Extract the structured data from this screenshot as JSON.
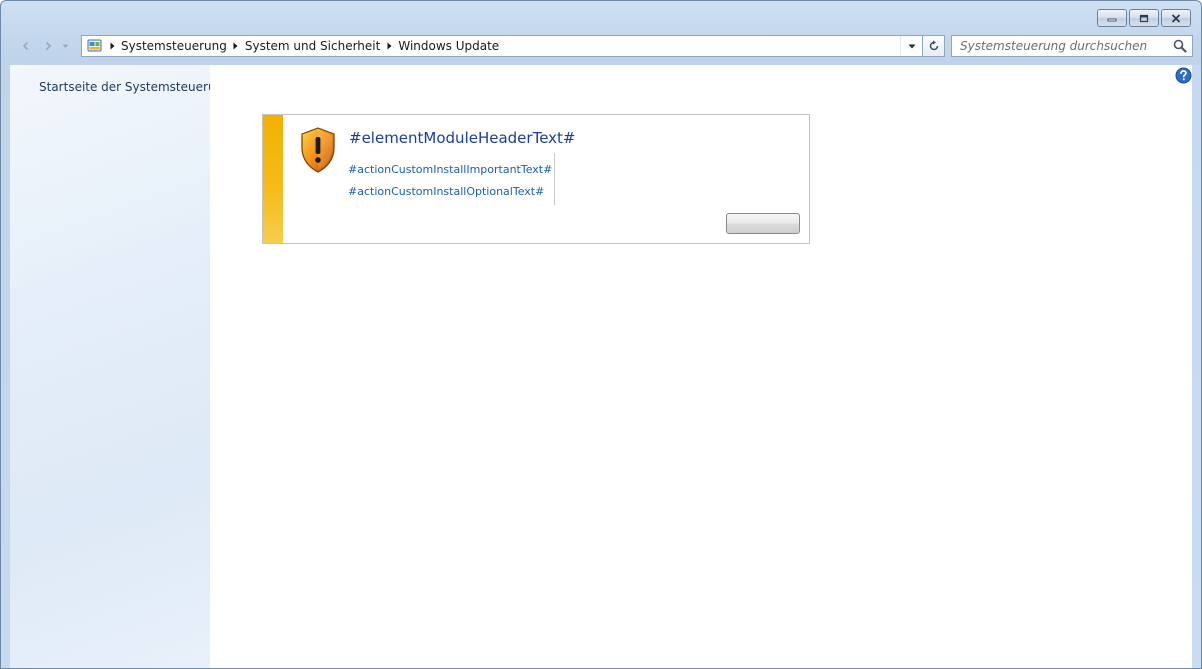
{
  "window": {
    "caption_buttons": [
      "minimize",
      "restore",
      "close"
    ]
  },
  "address_bar": {
    "breadcrumbs": [
      "Systemsteuerung",
      "System und Sicherheit",
      "Windows Update"
    ],
    "icon": "control-panel-icon"
  },
  "search": {
    "placeholder": "Systemsteuerung durchsuchen",
    "icon": "search-icon"
  },
  "sidebar": {
    "link": "Startseite der Systemsteuerung"
  },
  "module": {
    "header": "#elementModuleHeaderText#",
    "actions": [
      "#actionCustomInstallImportantText#",
      "#actionCustomInstallOptionalText#"
    ],
    "button_label": "",
    "icon": "warning-shield-icon",
    "stripe_color": "#f1b100"
  },
  "colors": {
    "link": "#1a5fb4",
    "header": "#1a3e9a"
  }
}
